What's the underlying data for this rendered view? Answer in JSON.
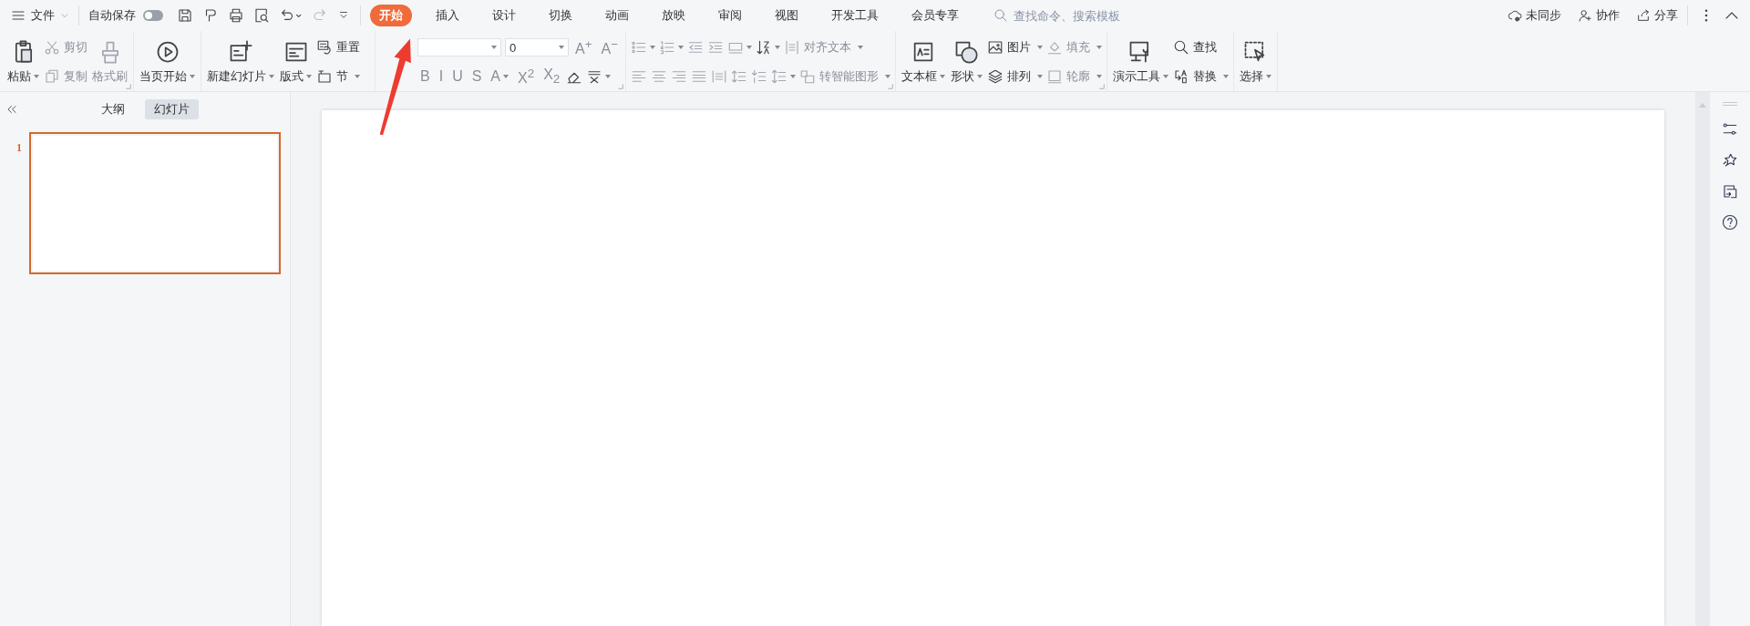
{
  "menu": {
    "label": "文件"
  },
  "autosave": {
    "label": "自动保存",
    "on": false
  },
  "tabs": [
    {
      "label": "开始",
      "selected": true
    },
    {
      "label": "插入",
      "selected": false
    },
    {
      "label": "设计",
      "selected": false
    },
    {
      "label": "切换",
      "selected": false
    },
    {
      "label": "动画",
      "selected": false
    },
    {
      "label": "放映",
      "selected": false
    },
    {
      "label": "审阅",
      "selected": false
    },
    {
      "label": "视图",
      "selected": false
    },
    {
      "label": "开发工具",
      "selected": false
    },
    {
      "label": "会员专享",
      "selected": false
    }
  ],
  "search": {
    "placeholder": "查找命令、搜索模板"
  },
  "actions": [
    {
      "label": "未同步"
    },
    {
      "label": "协作"
    },
    {
      "label": "分享"
    }
  ],
  "ribbon": [
    {
      "launcher": true,
      "columns": [
        {
          "rows": [
            [
              {
                "kind": "large",
                "label": "粘贴",
                "dropdown": true,
                "disabled": false
              }
            ]
          ]
        },
        {
          "rows": [
            [
              {
                "kind": "small",
                "label": "剪切",
                "dropdown": false,
                "disabled": true
              }
            ],
            [
              {
                "kind": "small",
                "label": "复制",
                "dropdown": false,
                "disabled": true
              }
            ]
          ]
        },
        {
          "rows": [
            [
              {
                "kind": "large",
                "label": "格式刷",
                "dropdown": false,
                "disabled": true
              }
            ]
          ]
        }
      ]
    },
    {
      "launcher": false,
      "columns": [
        {
          "rows": [
            [
              {
                "kind": "large",
                "label": "当页开始",
                "dropdown": true,
                "disabled": false
              }
            ]
          ]
        }
      ]
    },
    {
      "launcher": false,
      "columns": [
        {
          "rows": [
            [
              {
                "kind": "large",
                "label": "新建幻灯片",
                "dropdown": true,
                "disabled": false
              }
            ]
          ]
        },
        {
          "rows": [
            [
              {
                "kind": "large",
                "label": "版式",
                "dropdown": true,
                "disabled": false
              }
            ]
          ]
        },
        {
          "rows": [
            [
              {
                "kind": "small",
                "label": "重置",
                "dropdown": false,
                "disabled": false
              }
            ],
            [
              {
                "kind": "small",
                "label": "节",
                "dropdown": true,
                "disabled": false
              }
            ]
          ]
        }
      ]
    },
    {
      "launcher": true,
      "columns": [
        {
          "rows": [
            [
              {
                "kind": "font-combo",
                "dropdown": true,
                "disabled": false
              },
              {
                "kind": "size-combo",
                "value": "0",
                "dropdown": true,
                "disabled": false
              },
              {
                "kind": "glyph",
                "text": "A$^{+}$",
                "dropdown": false,
                "disabled": true
              },
              {
                "kind": "glyph",
                "text": "A$^{−}$",
                "dropdown": false,
                "disabled": true
              }
            ],
            [
              {
                "kind": "glyph",
                "text": "B",
                "dropdown": false,
                "disabled": true
              },
              {
                "kind": "glyph",
                "text": "I",
                "dropdown": false,
                "disabled": true
              },
              {
                "kind": "glyph",
                "text": "U",
                "dropdown": false,
                "disabled": true
              },
              {
                "kind": "glyph",
                "text": "S",
                "dropdown": false,
                "disabled": true
              },
              {
                "kind": "glyph",
                "text": "A",
                "dropdown": true,
                "disabled": true
              },
              {
                "kind": "glyph",
                "text": "X$^{2}$",
                "dropdown": false,
                "disabled": true
              },
              {
                "kind": "glyph",
                "text": "X$_{2}$",
                "dropdown": false,
                "disabled": true
              },
              {
                "kind": "icon",
                "dropdown": false,
                "disabled": false
              },
              {
                "kind": "icon",
                "dropdown": true,
                "disabled": false
              }
            ]
          ]
        }
      ]
    },
    {
      "launcher": true,
      "columns": [
        {
          "rows": [
            [
              {
                "kind": "icon",
                "dropdown": true,
                "disabled": true
              },
              {
                "kind": "icon",
                "dropdown": true,
                "disabled": true
              },
              {
                "kind": "icon",
                "dropdown": false,
                "disabled": true
              },
              {
                "kind": "icon",
                "dropdown": false,
                "disabled": true
              },
              {
                "kind": "icon",
                "dropdown": true,
                "disabled": true
              },
              {
                "kind": "icon",
                "dropdown": true,
                "disabled": false
              },
              {
                "kind": "small",
                "label": "对齐文本",
                "dropdown": true,
                "disabled": true
              }
            ],
            [
              {
                "kind": "icon",
                "dropdown": false,
                "disabled": true
              },
              {
                "kind": "icon",
                "dropdown": false,
                "disabled": true
              },
              {
                "kind": "icon",
                "dropdown": false,
                "disabled": true
              },
              {
                "kind": "icon",
                "dropdown": false,
                "disabled": true
              },
              {
                "kind": "icon",
                "dropdown": false,
                "disabled": true
              },
              {
                "kind": "icon",
                "dropdown": false,
                "disabled": true
              },
              {
                "kind": "icon",
                "dropdown": false,
                "disabled": true
              },
              {
                "kind": "icon",
                "dropdown": true,
                "disabled": true
              },
              {
                "kind": "small",
                "label": "转智能图形",
                "dropdown": true,
                "disabled": true
              }
            ]
          ]
        }
      ]
    },
    {
      "launcher": true,
      "columns": [
        {
          "rows": [
            [
              {
                "kind": "large",
                "label": "文本框",
                "dropdown": true,
                "disabled": false
              }
            ]
          ]
        },
        {
          "rows": [
            [
              {
                "kind": "large",
                "label": "形状",
                "dropdown": true,
                "disabled": false
              }
            ]
          ]
        },
        {
          "rows": [
            [
              {
                "kind": "small",
                "label": "图片",
                "dropdown": true,
                "disabled": false
              }
            ],
            [
              {
                "kind": "small",
                "label": "排列",
                "dropdown": true,
                "disabled": false
              }
            ]
          ]
        },
        {
          "rows": [
            [
              {
                "kind": "small",
                "label": "填充",
                "dropdown": true,
                "disabled": true
              }
            ],
            [
              {
                "kind": "small",
                "label": "轮廓",
                "dropdown": true,
                "disabled": true
              }
            ]
          ]
        }
      ]
    },
    {
      "launcher": false,
      "columns": [
        {
          "rows": [
            [
              {
                "kind": "large",
                "label": "演示工具",
                "dropdown": true,
                "disabled": false
              }
            ]
          ]
        },
        {
          "rows": [
            [
              {
                "kind": "small",
                "label": "查找",
                "dropdown": false,
                "disabled": false
              }
            ],
            [
              {
                "kind": "small",
                "label": "替换",
                "dropdown": true,
                "disabled": false
              }
            ]
          ]
        }
      ]
    },
    {
      "launcher": false,
      "columns": [
        {
          "rows": [
            [
              {
                "kind": "large",
                "label": "选择",
                "dropdown": true,
                "disabled": false
              }
            ]
          ]
        }
      ]
    }
  ],
  "panel": {
    "tabs": [
      {
        "label": "大纲",
        "selected": false
      },
      {
        "label": "幻灯片",
        "selected": true
      }
    ],
    "slides": [
      {
        "number": "1",
        "selected": true
      }
    ]
  }
}
